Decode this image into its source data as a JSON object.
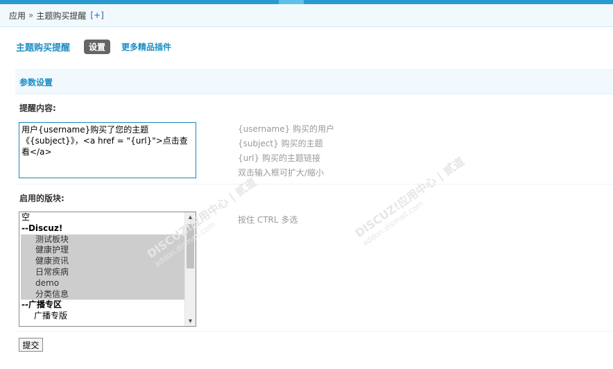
{
  "breadcrumb": {
    "root": "应用",
    "separator": "»",
    "current": "主题购买提醒",
    "add": "[+]"
  },
  "tabs": {
    "title": "主题购买提醒",
    "active": "设置",
    "more": "更多精品插件"
  },
  "section": {
    "title": "参数设置"
  },
  "reminder": {
    "label": "提醒内容:",
    "value": "用户{username}购买了您的主题《{subject}》，<a href = \"{url}\">点击查看</a>",
    "help": [
      {
        "code": "{username}",
        "text": " 购买的用户"
      },
      {
        "code": "{subject}",
        "text": " 购买的主题"
      },
      {
        "code": "{url}",
        "text": " 购买的主题链接"
      },
      {
        "code": "",
        "text": "双击输入框可扩大/缩小"
      }
    ]
  },
  "blocks": {
    "label": "启用的版块:",
    "help": "按住 CTRL 多选",
    "options": [
      {
        "text": "空",
        "kind": "none",
        "selected": false
      },
      {
        "text": "--Discuz!",
        "kind": "group",
        "selected": false
      },
      {
        "text": "测试板块",
        "kind": "item",
        "selected": true
      },
      {
        "text": "健康护理",
        "kind": "item",
        "selected": true
      },
      {
        "text": "健康资讯",
        "kind": "item",
        "selected": true
      },
      {
        "text": "日常疾病",
        "kind": "item",
        "selected": true
      },
      {
        "text": "demo",
        "kind": "item",
        "selected": true
      },
      {
        "text": "分类信息",
        "kind": "item",
        "selected": true
      },
      {
        "text": "--广播专区",
        "kind": "group",
        "selected": false
      },
      {
        "text": "广播专版",
        "kind": "item",
        "selected": false
      }
    ]
  },
  "submit": {
    "label": "提交"
  },
  "watermark": {
    "brand": "DISCUZ!应用中心 | 贰道",
    "site": "addon.dismall.com"
  },
  "colors": {
    "accent": "#1e8dc4",
    "topbar": "#2a9bd0",
    "header_bg": "#f2f9fd",
    "selected_bg": "#cdcdcd"
  },
  "icons": {
    "scroll_up": "triangle-up-icon",
    "scroll_down": "triangle-down-icon"
  }
}
